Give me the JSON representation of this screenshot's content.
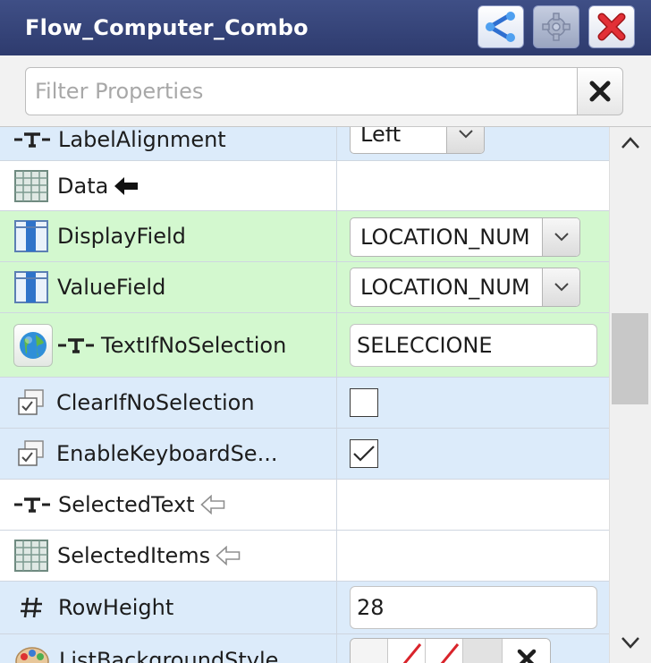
{
  "window": {
    "title": "Flow_Computer_Combo",
    "buttons": {
      "share_icon": "share-icon",
      "settings_icon": "gear-icon",
      "close_icon": "close-icon"
    }
  },
  "filter": {
    "placeholder": "Filter Properties",
    "value": "",
    "clear_icon": "close-icon"
  },
  "properties": [
    {
      "label": "LabelAlignment",
      "icon": "text-property-icon",
      "value": "Left",
      "editor": "dropdown"
    },
    {
      "label": "Data",
      "icon": "grid-table-icon",
      "marker": "input-arrow-icon",
      "value": "",
      "editor": "none"
    },
    {
      "label": "DisplayField",
      "icon": "column-icon",
      "value": "LOCATION_NUM",
      "editor": "dropdown"
    },
    {
      "label": "ValueField",
      "icon": "column-icon",
      "value": "LOCATION_NUM",
      "editor": "dropdown"
    },
    {
      "label": "TextIfNoSelection",
      "icon": "text-property-icon",
      "extra_icon": "globe-icon",
      "value": "SELECCIONE",
      "editor": "text"
    },
    {
      "label": "ClearIfNoSelection",
      "icon": "checkbox-property-icon",
      "value": "false",
      "editor": "checkbox"
    },
    {
      "label": "EnableKeyboardSe...",
      "icon": "checkbox-property-icon",
      "value": "true",
      "editor": "checkbox"
    },
    {
      "label": "SelectedText",
      "icon": "text-property-icon",
      "marker": "output-arrow-icon",
      "value": "",
      "editor": "none"
    },
    {
      "label": "SelectedItems",
      "icon": "grid-table-icon",
      "marker": "output-arrow-icon",
      "value": "",
      "editor": "none"
    },
    {
      "label": "RowHeight",
      "icon": "number-icon",
      "value": "28",
      "editor": "text"
    },
    {
      "label": "ListBackgroundStyle",
      "icon": "palette-icon",
      "value": "",
      "editor": "style-swatches"
    }
  ],
  "colors": {
    "titlebar": "#2e3b6e",
    "row_blue": "#dcebfa",
    "row_green": "#d3f8cf",
    "close_red": "#d9242b"
  }
}
